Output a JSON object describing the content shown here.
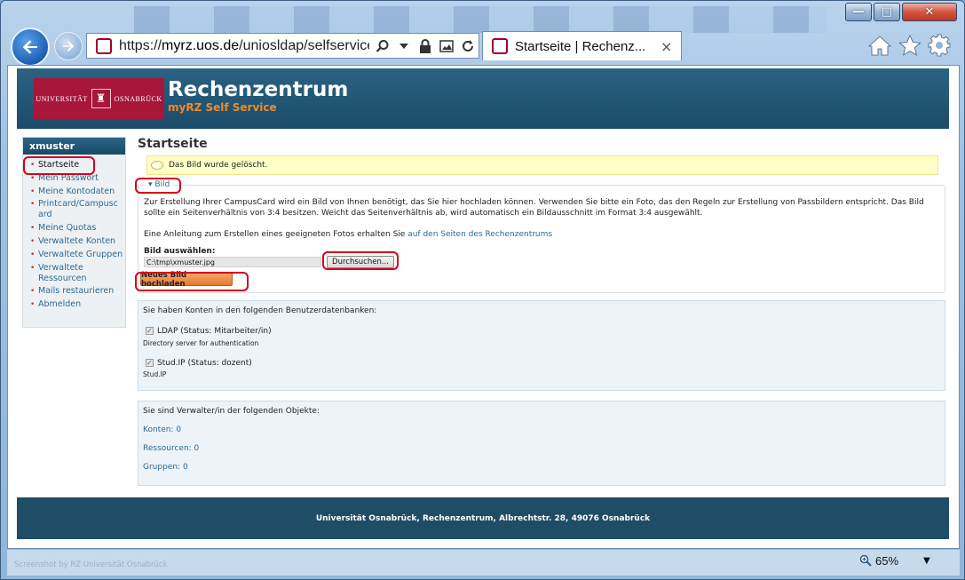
{
  "window": {
    "minimize_label": "—",
    "maximize_label": "□",
    "close_label": "✕"
  },
  "browser": {
    "url_prefix": "https://",
    "url_host": "myrz.uos.de",
    "url_path": "/uniosldap/selfservice/",
    "tab_title": "Startseite | Rechenz...",
    "tab_close": "×",
    "icons": [
      "back-icon",
      "forward-icon",
      "search-icon",
      "dropdown-icon",
      "lock-icon",
      "image-icon",
      "refresh-icon",
      "home-icon",
      "star-icon",
      "gear-icon"
    ]
  },
  "header": {
    "logo_text_left": "UNIVERSITÄT",
    "logo_text_right": "OSNABRÜCK",
    "title": "Rechenzentrum",
    "subtitle": "myRZ Self Service"
  },
  "sidebar": {
    "user": "xmuster",
    "items": [
      {
        "label": "Startseite"
      },
      {
        "label": "Mein Passwort"
      },
      {
        "label": "Meine Kontodaten"
      },
      {
        "label": "Printcard/Campuscard"
      },
      {
        "label": "Meine Quotas"
      },
      {
        "label": "Verwaltete Konten"
      },
      {
        "label": "Verwaltete Gruppen"
      },
      {
        "label": "Verwaltete Ressourcen"
      },
      {
        "label": "Mails restaurieren"
      },
      {
        "label": "Abmelden"
      }
    ]
  },
  "main": {
    "page_title": "Startseite",
    "notice": "Das Bild wurde gelöscht.",
    "bild": {
      "legend": "▾ Bild",
      "description": "Zur Erstellung Ihrer CampusCard wird ein Bild von Ihnen benötigt, das Sie hier hochladen können. Verwenden Sie bitte ein Foto, das den Regeln zur Erstellung von Passbildern entspricht. Das Bild sollte ein Seitenverhältnis von 3:4 besitzen. Weicht das Seitenverhältnis ab, wird automatisch ein Bildausschnitt im Format 3:4 ausgewählt.",
      "guide_text": "Eine Anleitung zum Erstellen eines geeigneten Fotos erhalten Sie ",
      "guide_link": "auf den Seiten des Rechenzentrums",
      "file_label": "Bild auswählen:",
      "file_value": "C:\\tmp\\xmuster.jpg",
      "browse_label": "Durchsuchen...",
      "upload_label": "Neues Bild hochladen"
    },
    "accounts": {
      "heading": "Sie haben Konten in den folgenden Benutzerdatenbanken:",
      "entries": [
        {
          "label": "LDAP (Status: Mitarbeiter/in)",
          "description": "Directory server for authentication",
          "checked": true
        },
        {
          "label": "Stud.IP (Status: dozent)",
          "description": "Stud.IP",
          "checked": true
        }
      ]
    },
    "objects": {
      "heading": "Sie sind Verwalter/in der folgenden Objekte:",
      "links": [
        "Konten: 0",
        "Ressourcen: 0",
        "Gruppen: 0"
      ]
    }
  },
  "footer": {
    "text": "Universität Osnabrück, Rechenzentrum, Albrechtstr. 28, 49076 Osnabrück"
  },
  "statusbar": {
    "watermark": "Screenshot by RZ Universität Osnabrück",
    "zoom": "65%"
  },
  "colors": {
    "highlight": "#d6001c",
    "header_bg": "#1b4c69",
    "brand_red": "#a8163a",
    "accent_orange": "#f08a2a",
    "link": "#2b6a96"
  }
}
